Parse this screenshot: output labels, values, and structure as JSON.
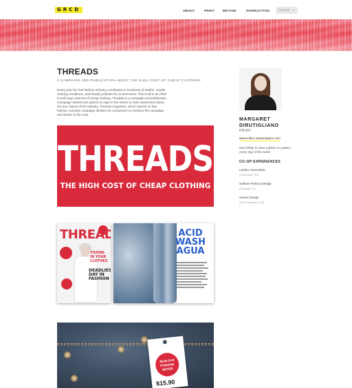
{
  "header": {
    "logo": "GRCD",
    "nav": [
      {
        "label": "ABOUT"
      },
      {
        "label": "PRINT"
      },
      {
        "label": "MOTION"
      },
      {
        "label": "INTERACTION"
      }
    ],
    "filters_label": "FILTERS",
    "filters_icon": "chevron-down-icon"
  },
  "project": {
    "title": "THREADS",
    "subtitle": "A CAMPAIGN AND PUBLICATION ABOUT THE HIGH COST OF CHEAP CLOTHING.",
    "description": "Every year the fast fashion industry contributes to hundreds of deaths, unsafe working conditions, and heavily pollutes the environment. This is all in an effort to sell huge volumes of cheap clothing. Threads is a campaign and publication. Campaign stickers are placed on tags in the stores to raise awareness about the true nature of the industry. Threads magazine, which reports on fast fashion, includes campaign stickers for consumers to continue the campaign and sticker to the man."
  },
  "poster": {
    "headline": "THREADS",
    "tagline": "THE HIGH COST OF CHEAP CLOTHING",
    "color": "#d92a3c"
  },
  "magazine": {
    "cover_title": "THREADS",
    "cover_line_1": "TOXINS IN YOUR CLOTHES",
    "cover_line_2": "DEADLIEST DAY IN FASHION",
    "spread_headline": "ACID WASH AGUA"
  },
  "tag": {
    "sticker_text": "JEAN DYE POISONS WATER",
    "price": "$15.90"
  },
  "designer": {
    "name": "MARGARET DIRUTIGLIANO",
    "discipline": "PRINT",
    "website": "www.mdiru.squarespace.com",
    "quote": "Most likely to wear pattern on pattern every day of the week.",
    "coop_heading": "CO-OP EXPERIENCES",
    "experiences": [
      {
        "company": "Landor Associates",
        "location": "(Cincinnati, OH)"
      },
      {
        "company": "Selbert Perkins Design",
        "location": "(Chicago, IL)"
      },
      {
        "company": "Seven Design",
        "location": "(San Francisco, CA)"
      }
    ]
  },
  "colors": {
    "accent_yellow": "#f5ea2a",
    "brand_red": "#d92a3c"
  }
}
